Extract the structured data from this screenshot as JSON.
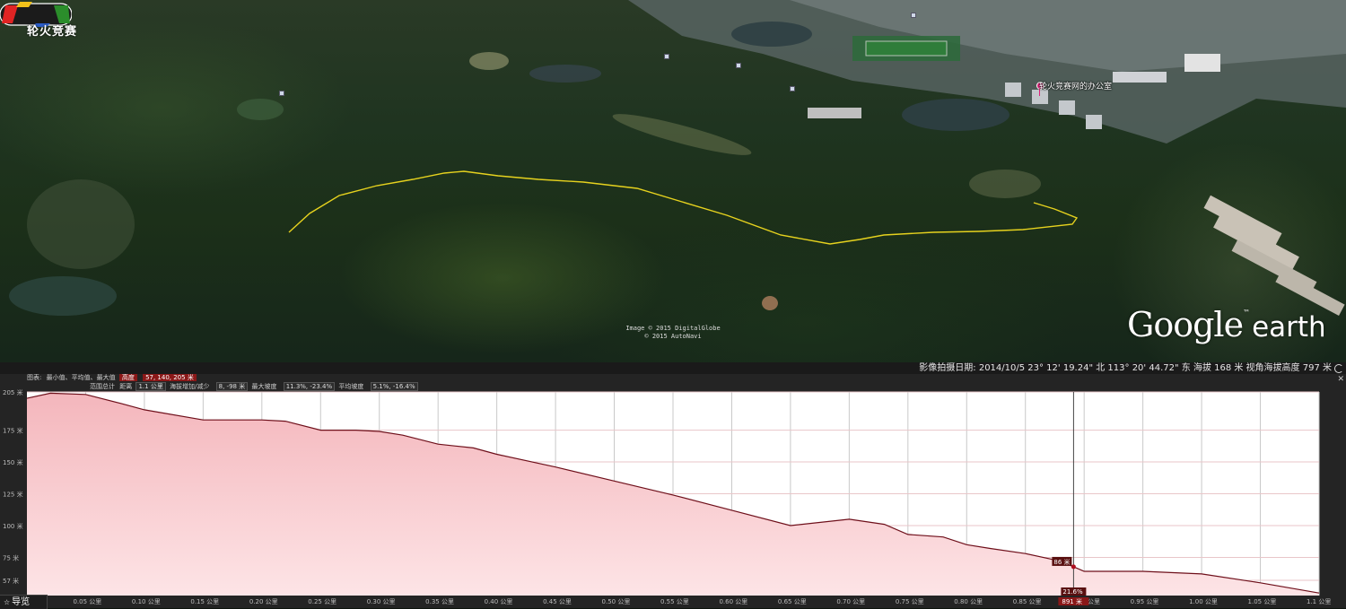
{
  "brand": {
    "logo_text": "轮火竞赛"
  },
  "map": {
    "place_label": "轮火竞赛网的办公室",
    "attribution": [
      "Image © 2015 DigitalGlobe",
      "© 2015 AutoNavi"
    ],
    "google_earth": {
      "google": "Google",
      "earth": "earth",
      "tm": "™"
    },
    "track_color": "#e6d21e"
  },
  "status_bar": {
    "text": "影像拍摄日期: 2014/10/5   23° 12' 19.24\" 北 113° 20' 44.72\" 东 海拔   168 米   视角海拔高度   797 米"
  },
  "profile": {
    "row1": {
      "label": "图表:",
      "stats": "最小值、平均值、最大值",
      "field": "高度",
      "value": "57, 140, 205 米"
    },
    "row2": [
      {
        "label": "范围总计",
        "field": "距离",
        "value": "1.1 公里"
      },
      {
        "label": "海拔增加/减少",
        "field": "",
        "value": "8, -98 米"
      },
      {
        "label": "最大坡度",
        "field": "",
        "value": "11.3%, -23.4%"
      },
      {
        "label": "平均坡度",
        "field": "",
        "value": "5.1%, -16.4%"
      }
    ],
    "cursor": {
      "value_label": "86 米",
      "x_label": "21.6%",
      "dist_label": "891 米"
    },
    "nav_label": "导览"
  },
  "colors": {
    "fill_top": "#f4b6bc",
    "fill_bottom": "#fde4e6",
    "line": "#6e0f1a",
    "highlight": "#8a1818"
  },
  "chart_data": {
    "type": "area",
    "title": "",
    "xlabel": "",
    "ylabel": "",
    "x_unit": "公里",
    "y_unit": "米",
    "xlim": [
      0,
      1.1
    ],
    "ylim": [
      45,
      205
    ],
    "y_ticks": [
      205,
      175,
      150,
      125,
      100,
      75,
      57
    ],
    "x_ticks": [
      0.05,
      0.1,
      0.15,
      0.2,
      0.25,
      0.3,
      0.35,
      0.4,
      0.45,
      0.5,
      0.55,
      0.6,
      0.65,
      0.7,
      0.75,
      0.8,
      0.85,
      0.9,
      0.95,
      1.0,
      1.05,
      1.1
    ],
    "x_tick_labels": [
      "0.05 公里",
      "0.10 公里",
      "0.15 公里",
      "0.20 公里",
      "0.25 公里",
      "0.30 公里",
      "0.35 公里",
      "0.40 公里",
      "0.45 公里",
      "0.50 公里",
      "0.55 公里",
      "0.60 公里",
      "0.65 公里",
      "0.70 公里",
      "0.75 公里",
      "0.80 公里",
      "0.85 公里",
      "0.90 公里",
      "0.95 公里",
      "1.00 公里",
      "1.05 公里",
      "1.1 公里"
    ],
    "x": [
      0,
      0.02,
      0.05,
      0.08,
      0.1,
      0.15,
      0.2,
      0.22,
      0.25,
      0.28,
      0.3,
      0.32,
      0.35,
      0.38,
      0.4,
      0.45,
      0.5,
      0.55,
      0.6,
      0.65,
      0.7,
      0.73,
      0.75,
      0.78,
      0.8,
      0.82,
      0.85,
      0.88,
      0.9,
      0.95,
      1.0,
      1.05,
      1.1
    ],
    "y": [
      200,
      204,
      203,
      196,
      191,
      183,
      183,
      182,
      175,
      175,
      174,
      171,
      164,
      161,
      156,
      146,
      135,
      124,
      112,
      100,
      105,
      101,
      93,
      91,
      85,
      82,
      78,
      72,
      64,
      64,
      62,
      55,
      47
    ]
  }
}
